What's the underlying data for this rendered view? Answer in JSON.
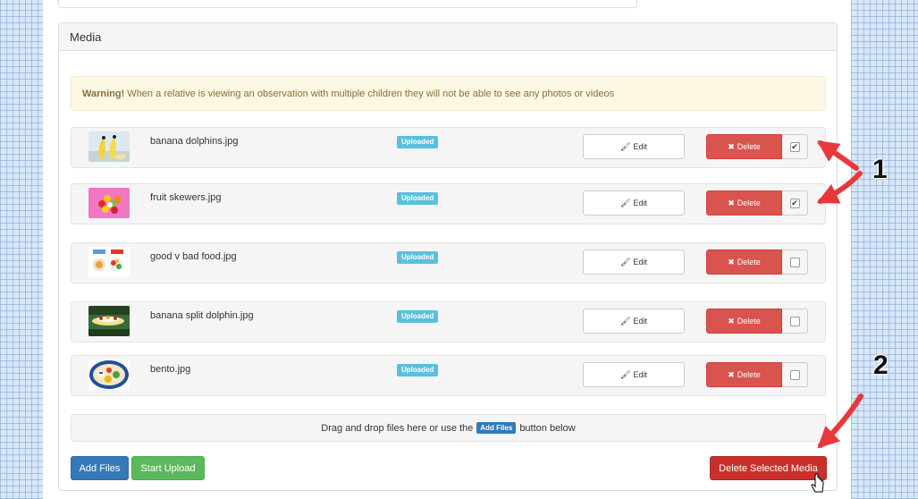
{
  "panel": {
    "title": "Media"
  },
  "warning": {
    "strong": "Warning!",
    "text": " When a relative is viewing an observation with multiple children they will not be able to see any photos or videos"
  },
  "files": [
    {
      "name": "banana dolphins.jpg",
      "status": "Uploaded",
      "edit_label": "Edit",
      "delete_label": "Delete",
      "checked": "✔"
    },
    {
      "name": "fruit skewers.jpg",
      "status": "Uploaded",
      "edit_label": "Edit",
      "delete_label": "Delete",
      "checked": "✔"
    },
    {
      "name": "good v bad food.jpg",
      "status": "Uploaded",
      "edit_label": "Edit",
      "delete_label": "Delete",
      "checked": ""
    },
    {
      "name": "banana split dolphin.jpg",
      "status": "Uploaded",
      "edit_label": "Edit",
      "delete_label": "Delete",
      "checked": ""
    },
    {
      "name": "bento.jpg",
      "status": "Uploaded",
      "edit_label": "Edit",
      "delete_label": "Delete",
      "checked": ""
    }
  ],
  "dropzone": {
    "before": "Drag and drop files here or use the",
    "button": "Add Files",
    "after": "button below"
  },
  "actions": {
    "add_files": "Add Files",
    "start_upload": "Start Upload",
    "delete_selected": "Delete Selected Media"
  },
  "annotations": {
    "one": "1",
    "two": "2"
  },
  "colors": {
    "danger": "#d9534f",
    "primary": "#337ab7",
    "success": "#5cb85c",
    "info": "#5bc0de",
    "arrow": "#e8383b"
  }
}
